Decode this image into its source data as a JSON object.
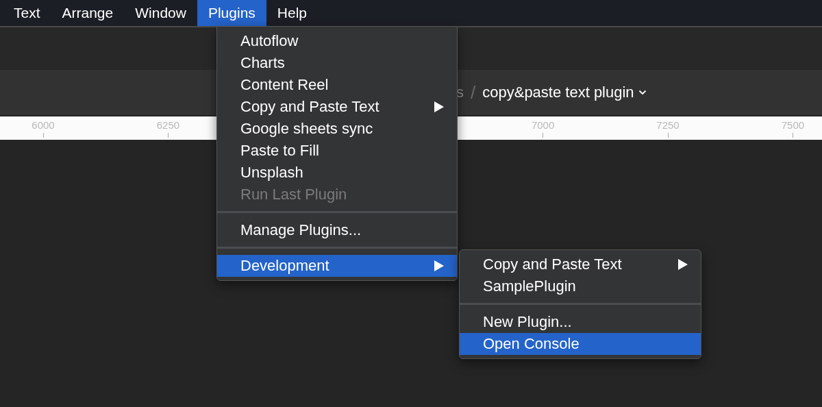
{
  "menu_bar": [
    {
      "label": "Text",
      "selected": false
    },
    {
      "label": "Arrange",
      "selected": false
    },
    {
      "label": "Window",
      "selected": false
    },
    {
      "label": "Plugins",
      "selected": true
    },
    {
      "label": "Help",
      "selected": false
    }
  ],
  "breadcrumb": {
    "parent": "s",
    "separator": "/",
    "current": "copy&paste text plugin"
  },
  "ruler": {
    "ticks": [
      "6000",
      "6250",
      "7000",
      "7250",
      "7500"
    ]
  },
  "plugins_menu": [
    {
      "kind": "item",
      "label": "Autoflow",
      "submenu": false,
      "disabled": false,
      "selected": false
    },
    {
      "kind": "item",
      "label": "Charts",
      "submenu": false,
      "disabled": false,
      "selected": false
    },
    {
      "kind": "item",
      "label": "Content Reel",
      "submenu": false,
      "disabled": false,
      "selected": false
    },
    {
      "kind": "item",
      "label": "Copy and Paste Text",
      "submenu": true,
      "disabled": false,
      "selected": false
    },
    {
      "kind": "item",
      "label": "Google sheets sync",
      "submenu": false,
      "disabled": false,
      "selected": false
    },
    {
      "kind": "item",
      "label": "Paste to Fill",
      "submenu": false,
      "disabled": false,
      "selected": false
    },
    {
      "kind": "item",
      "label": "Unsplash",
      "submenu": false,
      "disabled": false,
      "selected": false
    },
    {
      "kind": "item",
      "label": "Run Last Plugin",
      "submenu": false,
      "disabled": true,
      "selected": false
    },
    {
      "kind": "separator"
    },
    {
      "kind": "item",
      "label": "Manage Plugins...",
      "submenu": false,
      "disabled": false,
      "selected": false
    },
    {
      "kind": "separator"
    },
    {
      "kind": "item",
      "label": "Development",
      "submenu": true,
      "disabled": false,
      "selected": true
    }
  ],
  "development_submenu": [
    {
      "kind": "item",
      "label": "Copy and Paste Text",
      "submenu": true,
      "disabled": false,
      "selected": false
    },
    {
      "kind": "item",
      "label": "SamplePlugin",
      "submenu": false,
      "disabled": false,
      "selected": false
    },
    {
      "kind": "separator"
    },
    {
      "kind": "item",
      "label": "New Plugin...",
      "submenu": false,
      "disabled": false,
      "selected": false
    },
    {
      "kind": "item",
      "label": "Open Console",
      "submenu": false,
      "disabled": false,
      "selected": true
    }
  ]
}
